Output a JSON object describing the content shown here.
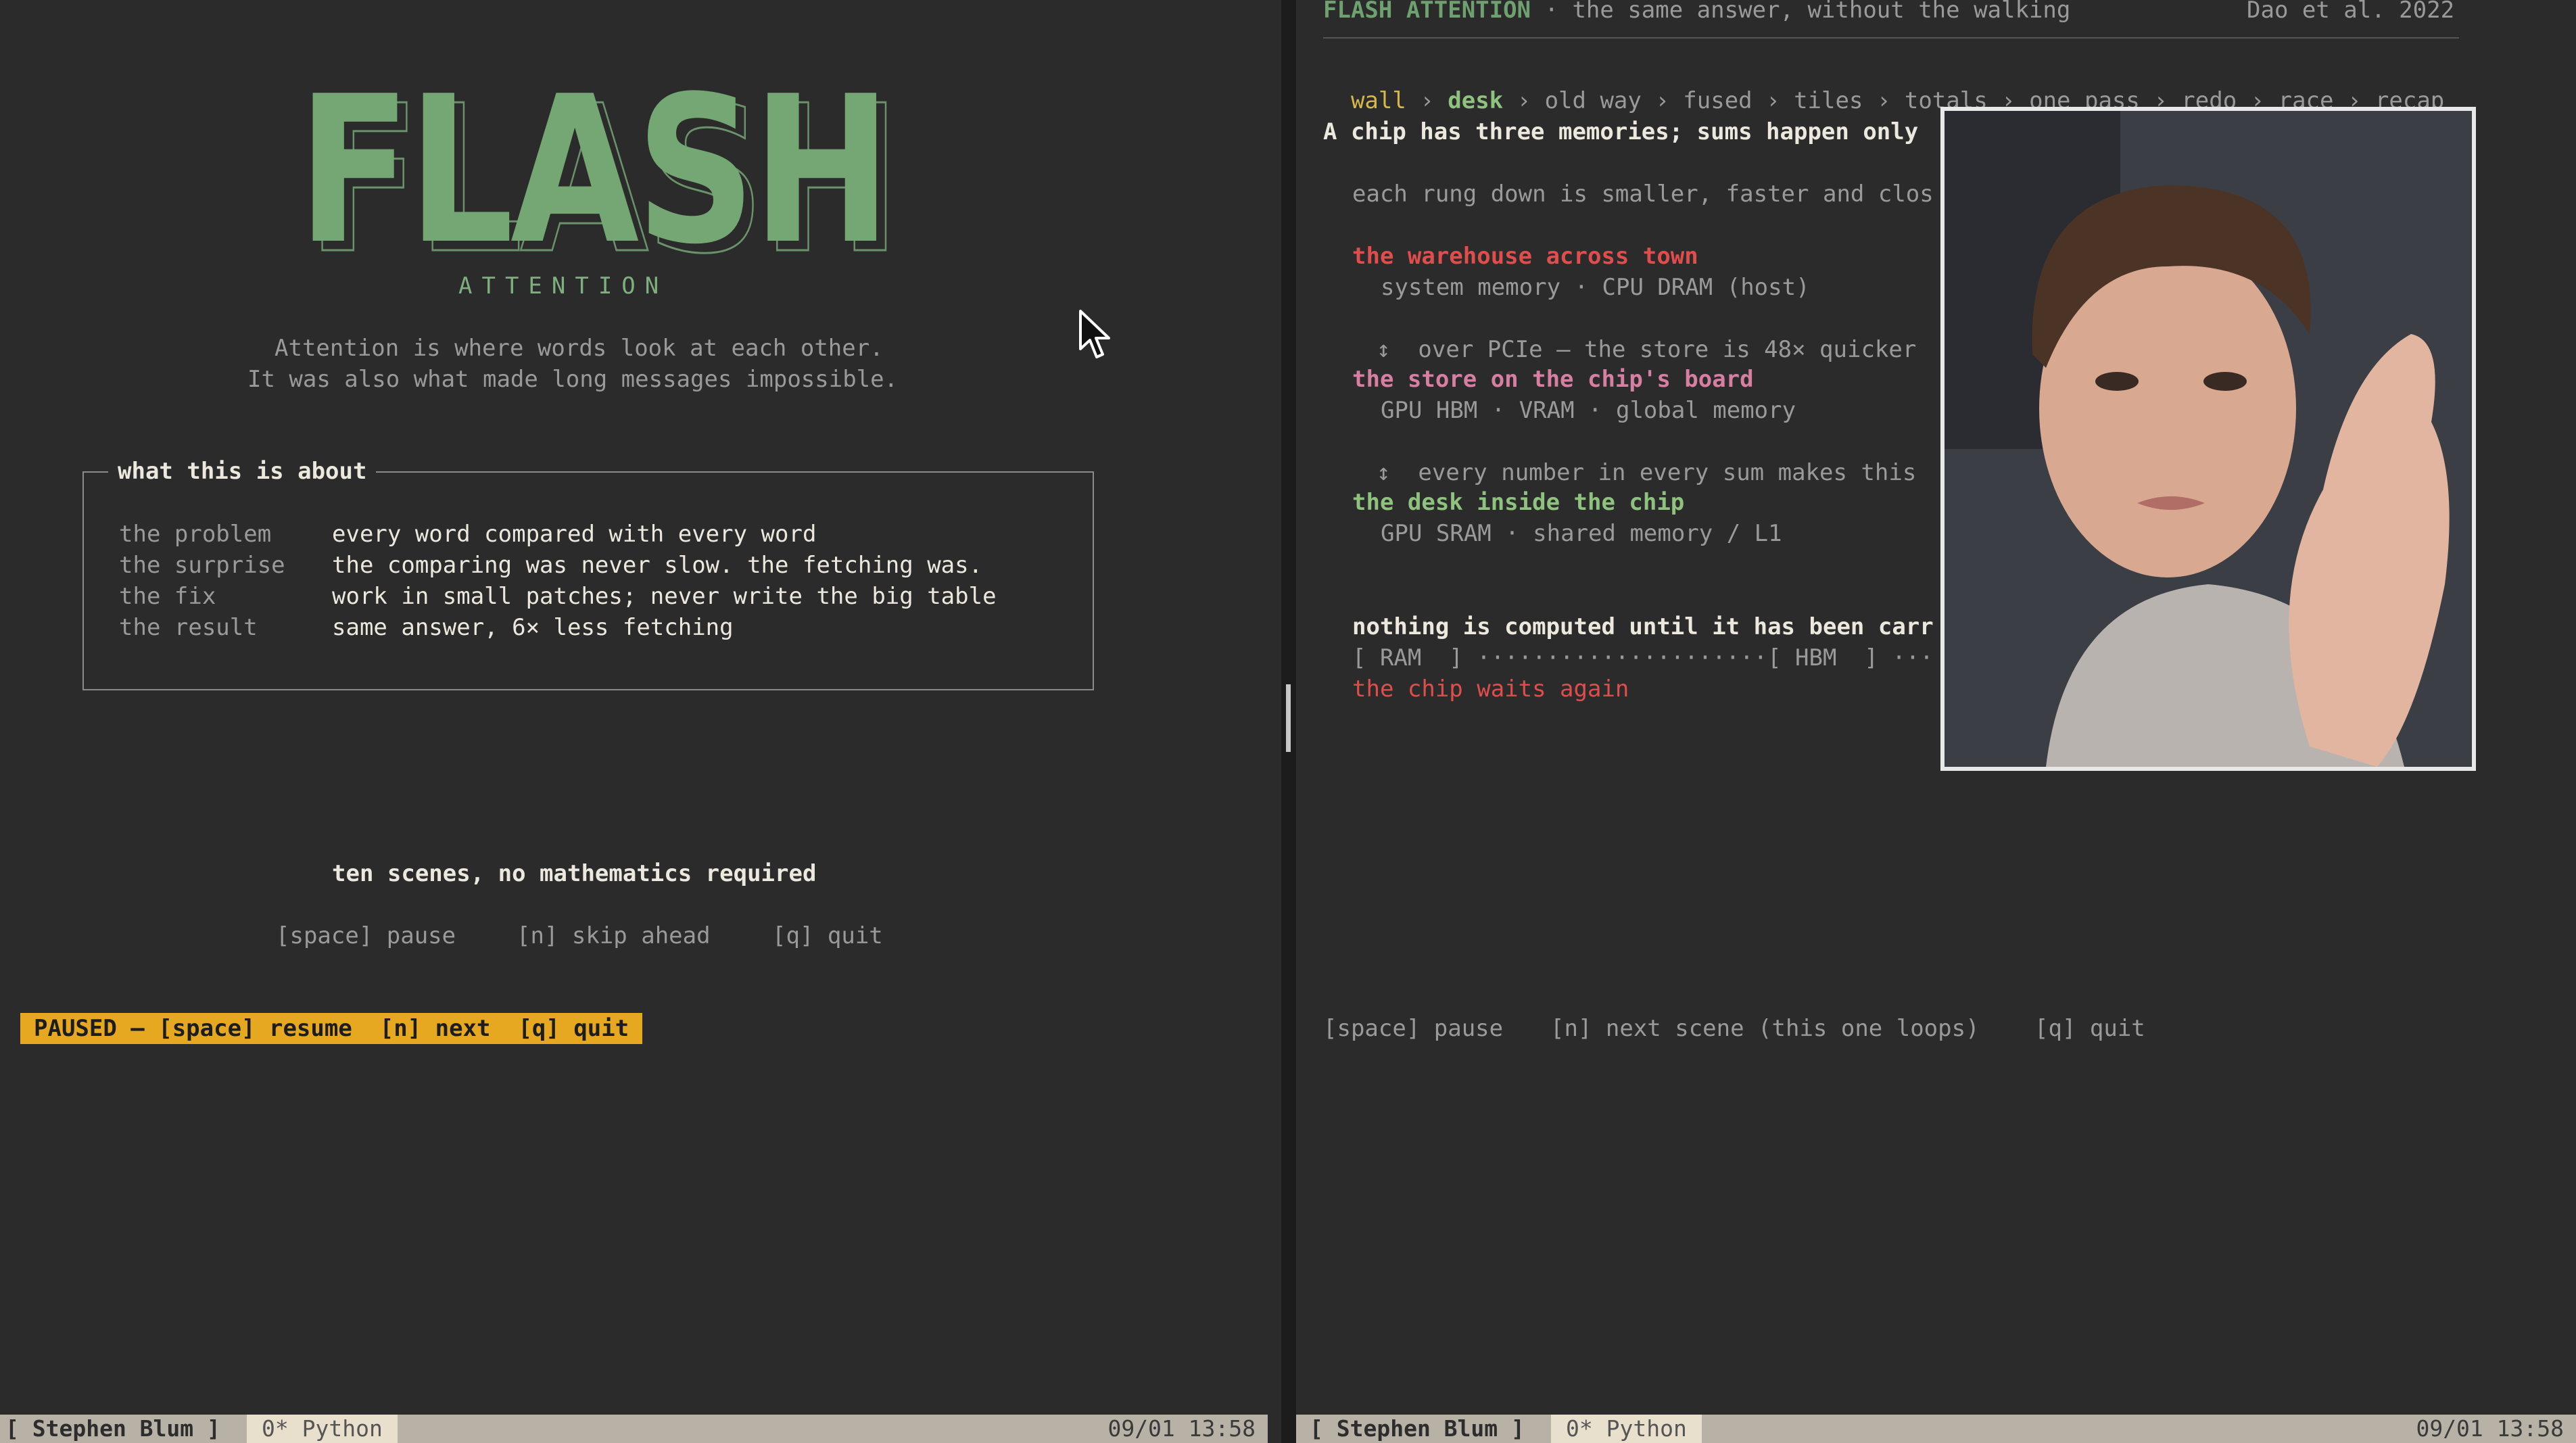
{
  "left": {
    "logo": {
      "text": "FLASH",
      "subtitle": "ATTENTION"
    },
    "intro": [
      "Attention is where words look at each other.",
      "It was also what made long messages impossible."
    ],
    "box": {
      "title": "what this is about",
      "rows": [
        {
          "label": "the problem",
          "value": "every word compared with every word"
        },
        {
          "label": "the surprise",
          "value": "the comparing was never slow. the fetching was."
        },
        {
          "label": "the fix",
          "value": "work in small patches; never write the big table"
        },
        {
          "label": "the result",
          "value": "same answer, 6× less fetching"
        }
      ]
    },
    "scenes_note": "ten scenes, no mathematics required",
    "keys": {
      "pause": "[space] pause",
      "skip": "[n] skip ahead",
      "quit": "[q] quit"
    },
    "paused_bar": "PAUSED — [space] resume  [n] next  [q] quit",
    "status": {
      "session": "[ Stephen Blum ]",
      "window": "0* Python",
      "clock": "09/01 13:58"
    }
  },
  "right": {
    "header": {
      "title": "FLASH ATTENTION",
      "tagline": " · the same answer, without the walking",
      "citation": "Dao et al. 2022"
    },
    "breadcrumb": [
      {
        "label": "wall",
        "state": "visited"
      },
      {
        "label": "desk",
        "state": "current"
      },
      {
        "label": "old way",
        "state": "upcoming"
      },
      {
        "label": "fused",
        "state": "upcoming"
      },
      {
        "label": "tiles",
        "state": "upcoming"
      },
      {
        "label": "totals",
        "state": "upcoming"
      },
      {
        "label": "one pass",
        "state": "upcoming"
      },
      {
        "label": "redo",
        "state": "upcoming"
      },
      {
        "label": "race",
        "state": "upcoming"
      },
      {
        "label": "recap",
        "state": "upcoming"
      }
    ],
    "breadcrumb_sep": "›",
    "heading": "A chip has three memories; sums happen only",
    "subheading": "each rung down is smaller, faster and clos",
    "tiers": [
      {
        "name": "the warehouse across town",
        "detail": "system memory · CPU DRAM (host)"
      },
      {
        "link": "↕  over PCIe — the store is 48× quicker"
      },
      {
        "name": "the store on the chip's board",
        "detail": "GPU HBM · VRAM · global memory"
      },
      {
        "link": "↕  every number in every sum makes this"
      },
      {
        "name": "the desk inside the chip",
        "detail": "GPU SRAM · shared memory / L1"
      }
    ],
    "carry_heading": "nothing is computed until it has been carr",
    "carry_line": "[ RAM  ] ·····················[ HBM  ] ···",
    "carry_status": "the chip waits again",
    "keys": {
      "pause": "[space] pause",
      "next": "[n] next scene (this one loops)",
      "quit": "[q] quit"
    },
    "status": {
      "session": "[ Stephen Blum ]",
      "window": "0* Python",
      "clock": "09/01 13:58"
    }
  },
  "colors": {
    "accent_green": "#74a774",
    "paused_yellow": "#e6a821",
    "warehouse_red": "#e04d4d",
    "store_pink": "#d77fa3",
    "desk_green": "#8fc27f",
    "crumb_visited": "#d7b74a"
  }
}
